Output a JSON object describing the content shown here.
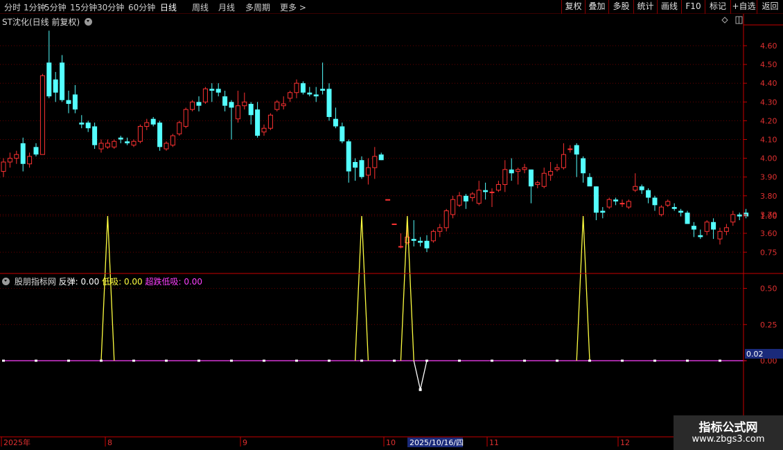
{
  "toolbar": {
    "periods": [
      "分时",
      "1分钟",
      "5分钟",
      "15分钟",
      "30分钟",
      "60分钟",
      "日线",
      "周线",
      "月线",
      "多周期",
      "更多 >"
    ],
    "active_period": "日线",
    "buttons": [
      "复权",
      "叠加",
      "多股",
      "统计",
      "画线",
      "F10",
      "标记",
      "+自选",
      "返回"
    ]
  },
  "main_chart": {
    "title": "ST沈化(日线 前复权)",
    "price_labels": [
      "4.60",
      "4.50",
      "4.40",
      "4.30",
      "4.20",
      "4.10",
      "4.00",
      "3.90",
      "3.80",
      "3.70",
      "3.60"
    ]
  },
  "indicator": {
    "name": "股朋指标网",
    "items": [
      {
        "label": "反弹:",
        "value": "0.00",
        "color": "#ffffff"
      },
      {
        "label": "低吸:",
        "value": "0.00",
        "color": "#ffff40"
      },
      {
        "label": "超跌低吸:",
        "value": "0.00",
        "color": "#ff40ff"
      }
    ],
    "axis_labels": [
      "1.00",
      "0.75",
      "0.50",
      "0.25",
      "0.00"
    ],
    "current_value": "0.02"
  },
  "time_axis": {
    "labels": [
      "2025年",
      "8",
      "9",
      "10",
      "11",
      "12"
    ],
    "cursor_label": "2025/10/16/四"
  },
  "watermark": {
    "line1": "指标公式网",
    "line2": "www.zbgs3.com"
  },
  "chart_data": [
    {
      "type": "candlestick",
      "title": "ST沈化(日线 前复权)",
      "ylim": [
        3.48,
        4.7
      ],
      "y_ticks": [
        3.6,
        3.7,
        3.8,
        3.9,
        4.0,
        4.1,
        4.2,
        4.3,
        4.4,
        4.5,
        4.6
      ],
      "x_month_labels": [
        "2025年",
        "8",
        "9",
        "10",
        "11",
        "12"
      ],
      "up_color": "#ff3232",
      "down_color": "#54ffff",
      "ohlc": [
        [
          3.93,
          4.0,
          3.9,
          3.98
        ],
        [
          3.98,
          4.03,
          3.95,
          4.0
        ],
        [
          4.0,
          4.04,
          3.97,
          4.02
        ],
        [
          4.08,
          4.11,
          3.93,
          3.97
        ],
        [
          3.97,
          4.03,
          3.95,
          4.01
        ],
        [
          4.06,
          4.08,
          4.01,
          4.02
        ],
        [
          4.02,
          4.45,
          4.02,
          4.44
        ],
        [
          4.51,
          4.68,
          4.32,
          4.33
        ],
        [
          4.42,
          4.46,
          4.3,
          4.35
        ],
        [
          4.51,
          4.55,
          4.3,
          4.31
        ],
        [
          4.31,
          4.36,
          4.24,
          4.29
        ],
        [
          4.34,
          4.39,
          4.24,
          4.26
        ],
        [
          4.19,
          4.23,
          4.16,
          4.18
        ],
        [
          4.19,
          4.2,
          4.14,
          4.16
        ],
        [
          4.17,
          4.19,
          4.05,
          4.07
        ],
        [
          4.05,
          4.1,
          4.03,
          4.08
        ],
        [
          4.06,
          4.1,
          4.05,
          4.08
        ],
        [
          4.06,
          4.1,
          4.05,
          4.09
        ],
        [
          4.11,
          4.12,
          4.08,
          4.1
        ],
        [
          4.09,
          4.11,
          4.07,
          4.08
        ],
        [
          4.07,
          4.1,
          4.06,
          4.09
        ],
        [
          4.09,
          4.18,
          4.08,
          4.17
        ],
        [
          4.17,
          4.21,
          4.15,
          4.19
        ],
        [
          4.21,
          4.22,
          4.17,
          4.18
        ],
        [
          4.19,
          4.2,
          4.04,
          4.06
        ],
        [
          4.05,
          4.09,
          4.04,
          4.08
        ],
        [
          4.07,
          4.13,
          4.06,
          4.12
        ],
        [
          4.13,
          4.2,
          4.12,
          4.19
        ],
        [
          4.17,
          4.27,
          4.16,
          4.26
        ],
        [
          4.26,
          4.31,
          4.25,
          4.3
        ],
        [
          4.3,
          4.33,
          4.25,
          4.28
        ],
        [
          4.3,
          4.38,
          4.29,
          4.37
        ],
        [
          4.37,
          4.4,
          4.3,
          4.36
        ],
        [
          4.37,
          4.4,
          4.33,
          4.35
        ],
        [
          4.33,
          4.36,
          4.25,
          4.28
        ],
        [
          4.3,
          4.31,
          4.1,
          4.27
        ],
        [
          4.21,
          4.36,
          4.19,
          4.28
        ],
        [
          4.28,
          4.35,
          4.26,
          4.3
        ],
        [
          4.29,
          4.3,
          4.18,
          4.23
        ],
        [
          4.26,
          4.3,
          4.11,
          4.12
        ],
        [
          4.14,
          4.18,
          4.12,
          4.16
        ],
        [
          4.16,
          4.24,
          4.15,
          4.23
        ],
        [
          4.26,
          4.31,
          4.25,
          4.3
        ],
        [
          4.28,
          4.33,
          4.26,
          4.29
        ],
        [
          4.32,
          4.36,
          4.3,
          4.35
        ],
        [
          4.35,
          4.42,
          4.32,
          4.4
        ],
        [
          4.4,
          4.41,
          4.34,
          4.35
        ],
        [
          4.35,
          4.38,
          4.33,
          4.34
        ],
        [
          4.34,
          4.38,
          4.3,
          4.33
        ],
        [
          4.37,
          4.51,
          4.34,
          4.36
        ],
        [
          4.37,
          4.4,
          4.2,
          4.22
        ],
        [
          4.21,
          4.27,
          4.16,
          4.17
        ],
        [
          4.17,
          4.19,
          4.08,
          4.09
        ],
        [
          4.09,
          4.1,
          3.87,
          3.93
        ],
        [
          3.98,
          4.0,
          3.88,
          3.95
        ],
        [
          3.99,
          4.01,
          3.89,
          3.9
        ],
        [
          3.91,
          4.0,
          3.86,
          3.95
        ],
        [
          3.95,
          4.06,
          3.89,
          4.01
        ],
        [
          4.02,
          4.03,
          3.99,
          3.99
        ],
        [
          3.78,
          3.78,
          3.78,
          3.78
        ],
        [
          3.65,
          3.65,
          3.65,
          3.65
        ],
        [
          3.53,
          3.6,
          3.52,
          3.53
        ],
        [
          3.55,
          3.64,
          3.54,
          3.58
        ],
        [
          3.57,
          3.67,
          3.53,
          3.56
        ],
        [
          3.56,
          3.58,
          3.53,
          3.55
        ],
        [
          3.56,
          3.59,
          3.5,
          3.52
        ],
        [
          3.56,
          3.62,
          3.55,
          3.61
        ],
        [
          3.61,
          3.65,
          3.58,
          3.63
        ],
        [
          3.63,
          3.73,
          3.61,
          3.72
        ],
        [
          3.7,
          3.8,
          3.68,
          3.78
        ],
        [
          3.75,
          3.82,
          3.74,
          3.8
        ],
        [
          3.8,
          3.81,
          3.73,
          3.77
        ],
        [
          3.79,
          3.82,
          3.77,
          3.81
        ],
        [
          3.76,
          3.88,
          3.75,
          3.83
        ],
        [
          3.83,
          3.87,
          3.78,
          3.82
        ],
        [
          3.82,
          3.84,
          3.74,
          3.82
        ],
        [
          3.83,
          3.88,
          3.82,
          3.86
        ],
        [
          3.86,
          3.99,
          3.82,
          3.94
        ],
        [
          3.94,
          4.0,
          3.88,
          3.92
        ],
        [
          3.93,
          3.95,
          3.86,
          3.94
        ],
        [
          3.94,
          3.97,
          3.92,
          3.95
        ],
        [
          3.94,
          3.94,
          3.76,
          3.85
        ],
        [
          3.86,
          3.88,
          3.84,
          3.87
        ],
        [
          3.85,
          3.95,
          3.84,
          3.92
        ],
        [
          3.91,
          3.98,
          3.88,
          3.93
        ],
        [
          3.94,
          3.97,
          3.93,
          3.95
        ],
        [
          3.95,
          4.08,
          3.94,
          4.02
        ],
        [
          4.05,
          4.07,
          4.03,
          4.05
        ],
        [
          4.07,
          4.08,
          3.9,
          4.02
        ],
        [
          4.0,
          4.01,
          3.87,
          3.92
        ],
        [
          3.9,
          3.92,
          3.86,
          3.85
        ],
        [
          3.85,
          3.85,
          3.67,
          3.71
        ],
        [
          3.72,
          3.74,
          3.68,
          3.71
        ],
        [
          3.74,
          3.79,
          3.73,
          3.78
        ],
        [
          3.78,
          3.79,
          3.75,
          3.77
        ],
        [
          3.76,
          3.78,
          3.74,
          3.76
        ],
        [
          3.74,
          3.78,
          3.73,
          3.77
        ],
        [
          3.83,
          3.92,
          3.82,
          3.85
        ],
        [
          3.85,
          3.86,
          3.81,
          3.83
        ],
        [
          3.83,
          3.84,
          3.76,
          3.79
        ],
        [
          3.79,
          3.8,
          3.72,
          3.75
        ],
        [
          3.7,
          3.75,
          3.69,
          3.74
        ],
        [
          3.75,
          3.78,
          3.74,
          3.77
        ],
        [
          3.74,
          3.76,
          3.72,
          3.73
        ],
        [
          3.72,
          3.73,
          3.69,
          3.71
        ],
        [
          3.71,
          3.72,
          3.65,
          3.65
        ],
        [
          3.64,
          3.66,
          3.58,
          3.62
        ],
        [
          3.59,
          3.62,
          3.57,
          3.58
        ],
        [
          3.61,
          3.67,
          3.59,
          3.66
        ],
        [
          3.66,
          3.68,
          3.57,
          3.62
        ],
        [
          3.57,
          3.63,
          3.54,
          3.61
        ],
        [
          3.61,
          3.65,
          3.59,
          3.63
        ],
        [
          3.66,
          3.72,
          3.64,
          3.7
        ],
        [
          3.7,
          3.71,
          3.67,
          3.69
        ],
        [
          3.71,
          3.73,
          3.68,
          3.69
        ]
      ]
    },
    {
      "type": "line",
      "title": "股朋指标网",
      "ylim": [
        -0.2,
        1.0
      ],
      "y_ticks": [
        0.0,
        0.25,
        0.5,
        0.75,
        1.0
      ],
      "series": [
        {
          "name": "反弹",
          "color": "#ffffff",
          "spikes": [
            {
              "index": 64,
              "value": -0.2
            }
          ]
        },
        {
          "name": "低吸",
          "color": "#ffff40",
          "spikes": [
            {
              "index": 16,
              "value": 1.0
            },
            {
              "index": 55,
              "value": 1.0
            },
            {
              "index": 62,
              "value": 1.0
            },
            {
              "index": 89,
              "value": 1.0
            }
          ]
        },
        {
          "name": "超跌低吸",
          "color": "#ff40ff",
          "spikes": []
        }
      ]
    }
  ]
}
